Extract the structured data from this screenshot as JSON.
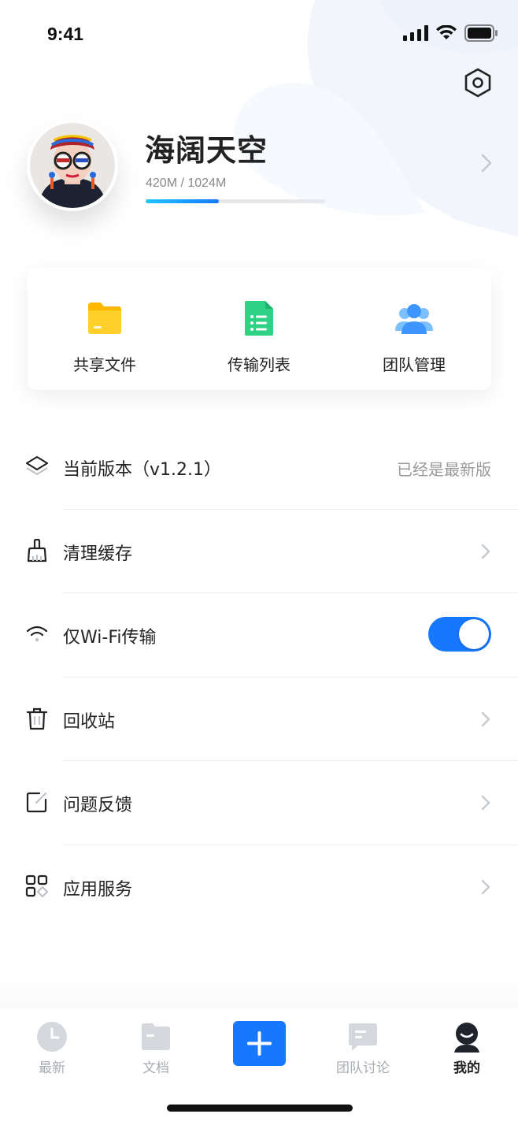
{
  "status_bar": {
    "time": "9:41"
  },
  "profile": {
    "name": "海阔天空",
    "storage_text": "420M / 1024M",
    "storage_used_fraction": 0.41
  },
  "quick_actions": [
    {
      "label": "共享文件",
      "icon": "folder-icon"
    },
    {
      "label": "传输列表",
      "icon": "document-list-icon"
    },
    {
      "label": "团队管理",
      "icon": "team-icon"
    }
  ],
  "menu": {
    "version": {
      "label": "当前版本（v1.2.1）",
      "status": "已经是最新版",
      "icon": "layers-icon"
    },
    "clear_cache": {
      "label": "清理缓存",
      "icon": "broom-icon"
    },
    "wifi_only": {
      "label": "仅Wi-Fi传输",
      "icon": "wifi-icon",
      "enabled": true
    },
    "recycle_bin": {
      "label": "回收站",
      "icon": "trash-icon"
    },
    "feedback": {
      "label": "问题反馈",
      "icon": "edit-icon"
    },
    "app_services": {
      "label": "应用服务",
      "icon": "apps-icon"
    }
  },
  "tab_bar": {
    "tabs": [
      {
        "label": "最新",
        "icon": "clock-icon"
      },
      {
        "label": "文档",
        "icon": "folder-icon"
      },
      {
        "label": "团队讨论",
        "icon": "chat-icon"
      },
      {
        "label": "我的",
        "icon": "user-icon"
      }
    ],
    "active": "我的"
  },
  "colors": {
    "accent": "#1677ff",
    "folder": "#ffc41f",
    "document": "#2fd184",
    "team": "#4aa3ff",
    "tab_inactive": "#a8acb3"
  }
}
